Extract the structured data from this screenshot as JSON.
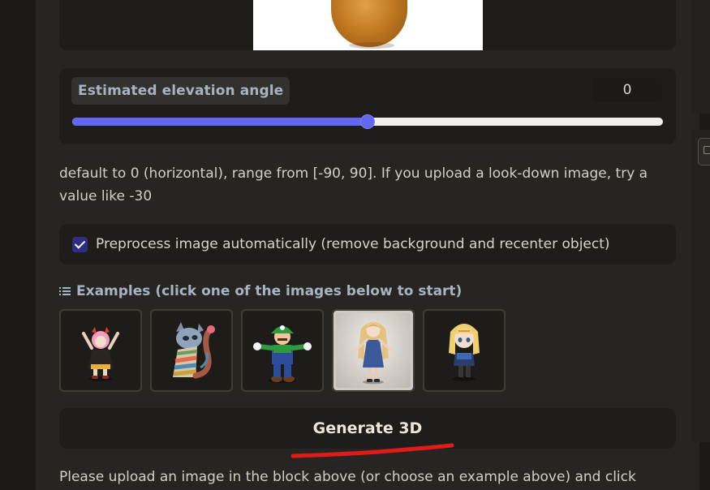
{
  "slider": {
    "label": "Estimated elevation angle",
    "value": "0",
    "min": -90,
    "max": 90,
    "current": 0,
    "accent": "#6366f1"
  },
  "info": {
    "text": "default to 0 (horizontal), range from [-90, 90]. If you upload a look-down image, try a value like -30"
  },
  "preprocess": {
    "label": "Preprocess image automatically (remove background and recenter object)",
    "checked": true
  },
  "examples": {
    "heading": "Examples (click one of the images below to start)",
    "items": [
      "pink-haired-girl",
      "striped-cat",
      "mario-luigi",
      "blonde-girl",
      "zelda-figure"
    ],
    "selected_index": 3
  },
  "generate": {
    "label": "Generate 3D"
  },
  "bottom": {
    "text": "Please upload an image in the block above (or choose an example above) and click"
  },
  "icons": {
    "list": "list-icon",
    "check": "check-icon"
  }
}
